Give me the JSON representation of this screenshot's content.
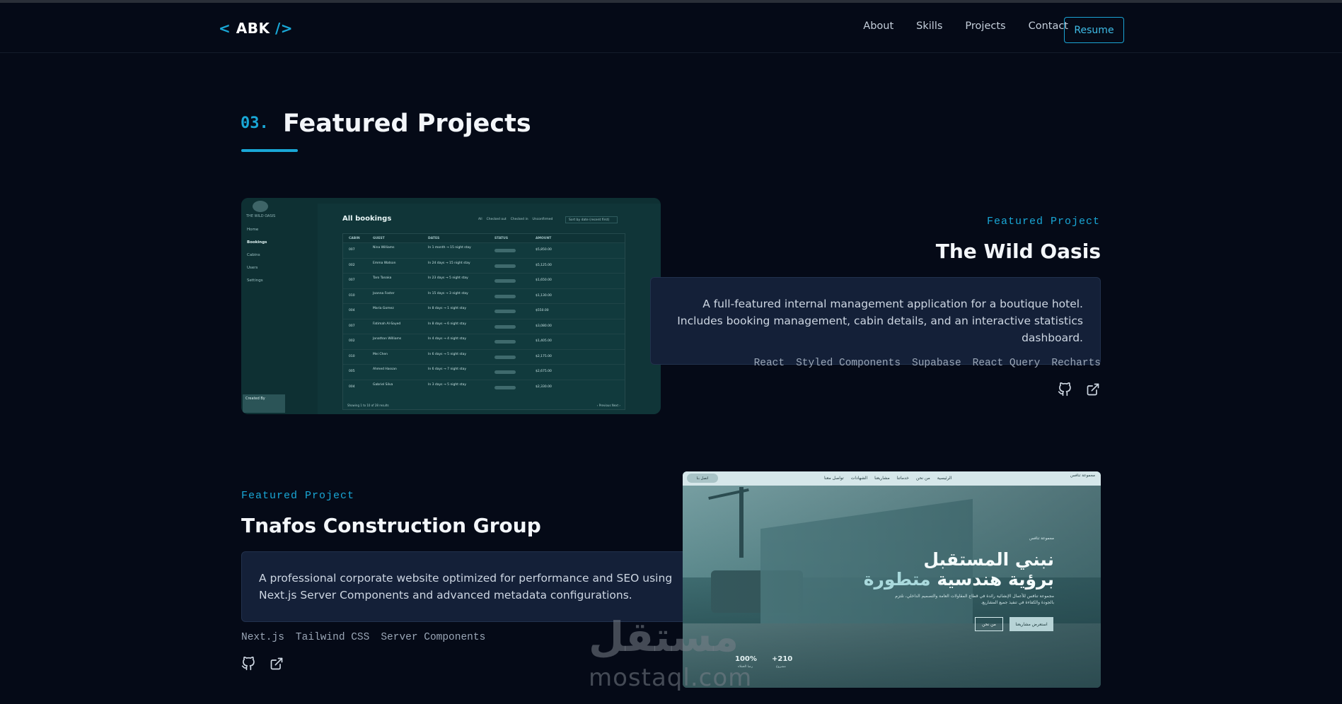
{
  "nav": {
    "logo_open": "<",
    "logo_text": "ABK",
    "logo_close": "/>",
    "links": [
      "About",
      "Skills",
      "Projects",
      "Contact"
    ],
    "resume": "Resume"
  },
  "section": {
    "number": "03.",
    "title": "Featured Projects"
  },
  "colors": {
    "background": "#050a17",
    "accent": "#19a7d6",
    "card": "#142038"
  },
  "projects": [
    {
      "eyebrow": "Featured Project",
      "title": "The Wild Oasis",
      "description": "A full-featured internal management application for a boutique hotel. Includes booking management, cabin details, and an interactive statistics dashboard.",
      "tags": [
        "React",
        "Styled Components",
        "Supabase",
        "React Query",
        "Recharts"
      ],
      "links": [
        "github-icon",
        "external-link-icon"
      ]
    },
    {
      "eyebrow": "Featured Project",
      "title": "Tnafos Construction Group",
      "description": "A professional corporate website optimized for performance and SEO using Next.js Server Components and advanced metadata configurations.",
      "tags": [
        "Next.js",
        "Tailwind CSS",
        "Server Components"
      ],
      "links": [
        "github-icon",
        "external-link-icon"
      ]
    }
  ],
  "shot1": {
    "brand": "THE WILD OASIS",
    "nav": [
      "Home",
      "Bookings",
      "Cabins",
      "Users",
      "Settings"
    ],
    "heading": "All bookings",
    "filters": [
      "All",
      "Checked out",
      "Checked in",
      "Unconfirmed"
    ],
    "sort": "Sort by date (recent first)",
    "columns": [
      "CABIN",
      "GUEST",
      "DATES",
      "STATUS",
      "AMOUNT"
    ],
    "rows": [
      {
        "cabin": "007",
        "guest": "Nina Williams",
        "dates": "In 1 month → 15 night stay",
        "amount": "$5,850.00"
      },
      {
        "cabin": "002",
        "guest": "Emma Watson",
        "dates": "In 24 days → 15 night stay",
        "amount": "$5,125.00"
      },
      {
        "cabin": "007",
        "guest": "Taro Tanaka",
        "dates": "In 23 days → 5 night stay",
        "amount": "$1,650.00"
      },
      {
        "cabin": "010",
        "guest": "Joanna Foster",
        "dates": "In 15 days → 3 night stay",
        "amount": "$1,130.00"
      },
      {
        "cabin": "004",
        "guest": "Maria Gomez",
        "dates": "In 8 days → 1 night stay",
        "amount": "$550.00"
      },
      {
        "cabin": "007",
        "guest": "Fatimah Al-Sayed",
        "dates": "In 8 days → 6 night stay",
        "amount": "$3,080.00"
      },
      {
        "cabin": "002",
        "guest": "Jonathan Williams",
        "dates": "In 4 days → 4 night stay",
        "amount": "$1,405.00"
      },
      {
        "cabin": "010",
        "guest": "Mei Chen",
        "dates": "In 6 days → 5 night stay",
        "amount": "$2,175.00"
      },
      {
        "cabin": "005",
        "guest": "Ahmed Hassan",
        "dates": "In 6 days → 7 night stay",
        "amount": "$2,675.00"
      },
      {
        "cabin": "004",
        "guest": "Gabriel Silva",
        "dates": "In 3 days → 5 night stay",
        "amount": "$2,330.00"
      }
    ],
    "footer": "Showing 1 to 10 of 28 results",
    "pagination": "‹ Previous   Next ›",
    "created_by": "Created By"
  },
  "shot2": {
    "nav": [
      "تواصل معنا",
      "الشهادات",
      "مشاريعنا",
      "خدماتنا",
      "من نحن",
      "الرئيسية"
    ],
    "cta": "اتصل بنا",
    "brand": "مجموعة تنافس",
    "small": "مجموعة تنافس",
    "headline1": "نبني المستقبل",
    "headline2_a": "برؤية هندسية",
    "headline2_b": "متطورة",
    "paragraph": "مجموعة تنافس للأعمال الإنشائية رائدة في قطاع المقاولات العامة والتصميم الداخلي، نلتزم بالجودة والكفاءة في تنفيذ جميع المشاريع.",
    "button_primary": "استعرض مشاريعنا",
    "button_secondary": "من نحن",
    "stats": [
      {
        "value": "100%",
        "label": "رضا العملاء"
      },
      {
        "value": "+210",
        "label": "مشروع"
      }
    ]
  },
  "watermark": {
    "arabic": "مستقل",
    "latin": "mostaql.com"
  }
}
